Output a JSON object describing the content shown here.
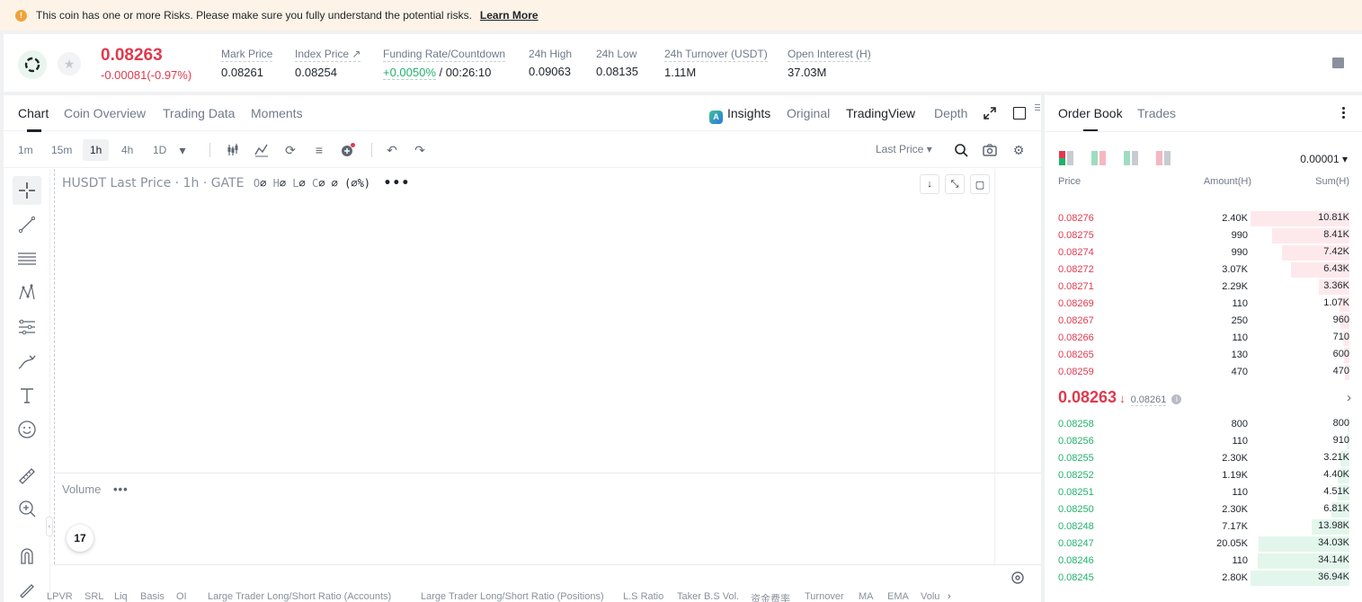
{
  "banner": {
    "icon": "warning-icon",
    "message": "This coin has one or more Risks. Please make sure you fully understand the potential risks.",
    "link": "Learn More"
  },
  "ticker": {
    "last_price": "0.08263",
    "change": "-0.00081(-0.97%)",
    "stats": [
      {
        "label": "Mark Price",
        "value": "0.08261"
      },
      {
        "label": "Index Price ↗",
        "value": "0.08254"
      },
      {
        "label": "Funding Rate/Countdown",
        "rate": "+0.0050%",
        "countdown": " / 00:26:10"
      },
      {
        "label": "24h High",
        "value": "0.09063"
      },
      {
        "label": "24h Low",
        "value": "0.08135"
      },
      {
        "label": "24h Turnover (USDT)",
        "value": "1.11M"
      },
      {
        "label": "Open Interest (H)",
        "value": "37.03M"
      }
    ]
  },
  "chart": {
    "tabs": [
      "Chart",
      "Coin Overview",
      "Trading Data",
      "Moments"
    ],
    "active_tab": "Chart",
    "views": [
      "Insights",
      "Original",
      "TradingView",
      "Depth"
    ],
    "active_view": "TradingView",
    "timeframes": [
      "1m",
      "15m",
      "1h",
      "4h",
      "1D"
    ],
    "active_timeframe": "1h",
    "price_source": "Last Price",
    "legend": {
      "symbol": "HUSDT Last Price · 1h · GATE",
      "o_key": "O",
      "o": "∅",
      "h_key": "H",
      "h": "∅",
      "l_key": "L",
      "l": "∅",
      "c_key": "C",
      "c": "∅ ∅ (∅%)"
    },
    "volume_label": "Volume",
    "tv_logo": "17",
    "indicators": [
      "LPVR",
      "SRL",
      "Liq",
      "Basis",
      "OI",
      "Large Trader Long/Short Ratio (Accounts)",
      "Large Trader Long/Short Ratio (Positions)",
      "L.S Ratio",
      "Taker B.S Vol.",
      "资金费率",
      "Turnover",
      "MA",
      "EMA",
      "Volu"
    ]
  },
  "orderbook": {
    "tabs": [
      "Order Book",
      "Trades"
    ],
    "active_tab": "Order Book",
    "precision": "0.00001",
    "headers": {
      "price": "Price",
      "amount": "Amount(H)",
      "sum": "Sum(H)"
    },
    "asks": [
      {
        "price": "0.08276",
        "amount": "2.40K",
        "sum": "10.81K",
        "depth": 1.0
      },
      {
        "price": "0.08275",
        "amount": "990",
        "sum": "8.41K",
        "depth": 0.778
      },
      {
        "price": "0.08274",
        "amount": "990",
        "sum": "7.42K",
        "depth": 0.686
      },
      {
        "price": "0.08272",
        "amount": "3.07K",
        "sum": "6.43K",
        "depth": 0.595
      },
      {
        "price": "0.08271",
        "amount": "2.29K",
        "sum": "3.36K",
        "depth": 0.311
      },
      {
        "price": "0.08269",
        "amount": "110",
        "sum": "1.07K",
        "depth": 0.099
      },
      {
        "price": "0.08267",
        "amount": "250",
        "sum": "960",
        "depth": 0.089
      },
      {
        "price": "0.08266",
        "amount": "110",
        "sum": "710",
        "depth": 0.066
      },
      {
        "price": "0.08265",
        "amount": "130",
        "sum": "600",
        "depth": 0.056
      },
      {
        "price": "0.08259",
        "amount": "470",
        "sum": "470",
        "depth": 0.043
      }
    ],
    "mid": {
      "price": "0.08263",
      "arrow": "↓",
      "mark": "0.08261",
      "info": "i",
      "chevron": "›"
    },
    "bids": [
      {
        "price": "0.08258",
        "amount": "800",
        "sum": "800",
        "depth": 0.022
      },
      {
        "price": "0.08256",
        "amount": "110",
        "sum": "910",
        "depth": 0.025
      },
      {
        "price": "0.08255",
        "amount": "2.30K",
        "sum": "3.21K",
        "depth": 0.087
      },
      {
        "price": "0.08252",
        "amount": "1.19K",
        "sum": "4.40K",
        "depth": 0.119
      },
      {
        "price": "0.08251",
        "amount": "110",
        "sum": "4.51K",
        "depth": 0.122
      },
      {
        "price": "0.08250",
        "amount": "2.30K",
        "sum": "6.81K",
        "depth": 0.184
      },
      {
        "price": "0.08248",
        "amount": "7.17K",
        "sum": "13.98K",
        "depth": 0.378
      },
      {
        "price": "0.08247",
        "amount": "20.05K",
        "sum": "34.03K",
        "depth": 0.921
      },
      {
        "price": "0.08246",
        "amount": "110",
        "sum": "34.14K",
        "depth": 0.924
      },
      {
        "price": "0.08245",
        "amount": "2.80K",
        "sum": "36.94K",
        "depth": 1.0
      }
    ]
  },
  "colors": {
    "ask": "#e0394e",
    "bid": "#20b26c",
    "banner_bg": "#fdf3e7"
  }
}
